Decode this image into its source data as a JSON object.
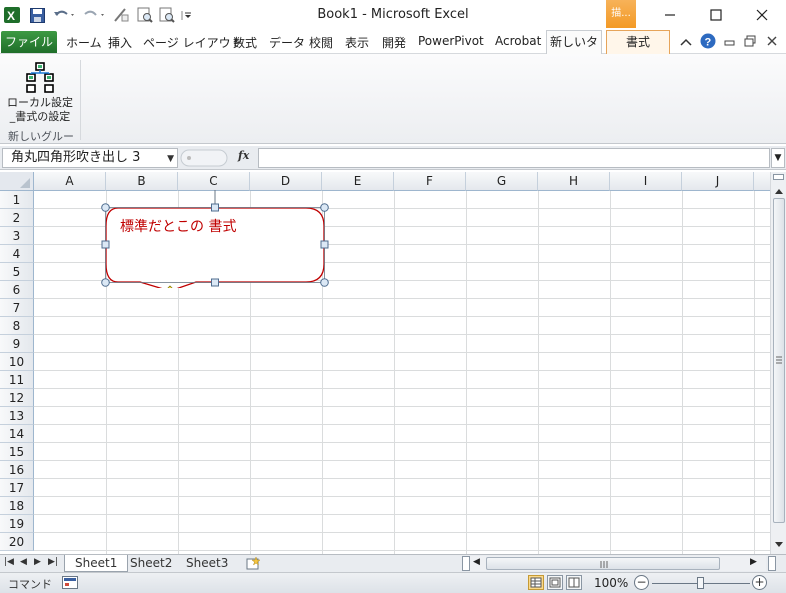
{
  "title_bar": {
    "window_title": "Book1 - Microsoft Excel",
    "context_tab_header": "描..."
  },
  "ribbon_tabs": {
    "file": "ファイル",
    "items": [
      "ホーム",
      "挿入",
      "ページ レイアウト",
      "数式",
      "データ",
      "校閲",
      "表示",
      "開発",
      "PowerPivot",
      "Acrobat"
    ],
    "active": "新しいタブ",
    "context": "書式"
  },
  "ribbon": {
    "button_label_line1": "ローカル設定",
    "button_label_line2": "_書式の設定",
    "group_label": "新しいグループ"
  },
  "formula_bar": {
    "name_box": "角丸四角形吹き出し 3",
    "fx_label": "fx",
    "formula": ""
  },
  "grid": {
    "columns": [
      "A",
      "B",
      "C",
      "D",
      "E",
      "F",
      "G",
      "H",
      "I",
      "J"
    ],
    "rows": [
      "1",
      "2",
      "3",
      "4",
      "5",
      "6",
      "7",
      "8",
      "9",
      "10",
      "11",
      "12",
      "13",
      "14",
      "15",
      "16",
      "17",
      "18",
      "19",
      "20"
    ]
  },
  "shape": {
    "text": "標準だとこの 書式",
    "text_color": "#c00000",
    "border_color": "#c00000"
  },
  "sheets": {
    "tabs": [
      "Sheet1",
      "Sheet2",
      "Sheet3"
    ],
    "active": "Sheet1"
  },
  "status_bar": {
    "mode": "コマンド",
    "zoom": "100%"
  },
  "colors": {
    "file_tab": "#2a7d31",
    "context_tab": "#f39a26",
    "header_bg": "#e4e8ed",
    "gridline": "#dadcdd"
  }
}
